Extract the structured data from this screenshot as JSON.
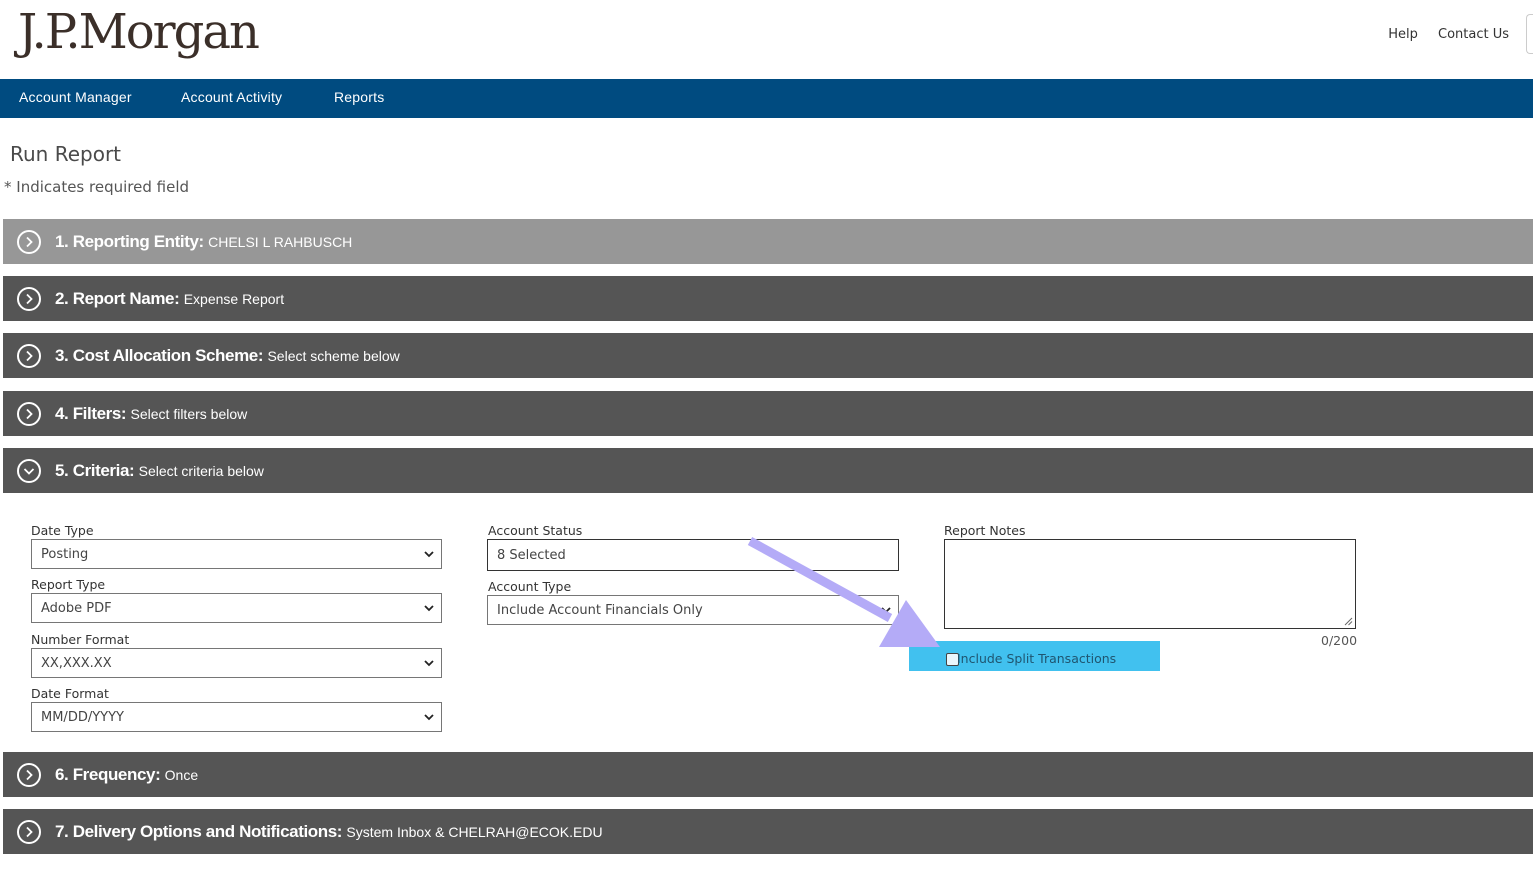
{
  "brand": {
    "logo_text": "J.P.Morgan"
  },
  "top_links": {
    "help": "Help",
    "contact": "Contact Us"
  },
  "nav": {
    "items": [
      "Account Manager",
      "Account Activity",
      "Reports"
    ]
  },
  "page": {
    "title": "Run Report",
    "required_note": "* Indicates required field"
  },
  "sections": [
    {
      "title": "1. Reporting Entity:",
      "value": "CHELSI L RAHBUSCH",
      "expanded": false
    },
    {
      "title": "2. Report Name:",
      "value": "Expense Report",
      "expanded": false
    },
    {
      "title": "3. Cost Allocation Scheme:",
      "value": "Select scheme below",
      "expanded": false
    },
    {
      "title": "4. Filters:",
      "value": "Select filters below",
      "expanded": false
    },
    {
      "title": "5. Criteria:",
      "value": "Select criteria below",
      "expanded": true
    },
    {
      "title": "6. Frequency:",
      "value": "Once",
      "expanded": false
    },
    {
      "title": "7. Delivery Options and Notifications:",
      "value": "System Inbox & CHELRAH@ECOK.EDU",
      "expanded": false
    }
  ],
  "criteria": {
    "date_type": {
      "label": "Date Type",
      "value": "Posting"
    },
    "report_type": {
      "label": "Report Type",
      "value": "Adobe PDF"
    },
    "number_format": {
      "label": "Number Format",
      "value": "XX,XXX.XX"
    },
    "date_format": {
      "label": "Date Format",
      "value": "MM/DD/YYYY"
    },
    "account_status": {
      "label": "Account Status",
      "value": "8 Selected"
    },
    "account_type": {
      "label": "Account Type",
      "value": "Include Account Financials Only"
    },
    "report_notes": {
      "label": "Report Notes",
      "value": "",
      "counter": "0/200"
    },
    "split_transactions": {
      "label": "Include Split Transactions",
      "checked": false
    }
  },
  "colors": {
    "nav_bg": "#004b80",
    "section_bg": "#555555",
    "section_first_bg": "#979797",
    "highlight": "#41c1ef",
    "annotation_arrow": "#b4abf7"
  }
}
